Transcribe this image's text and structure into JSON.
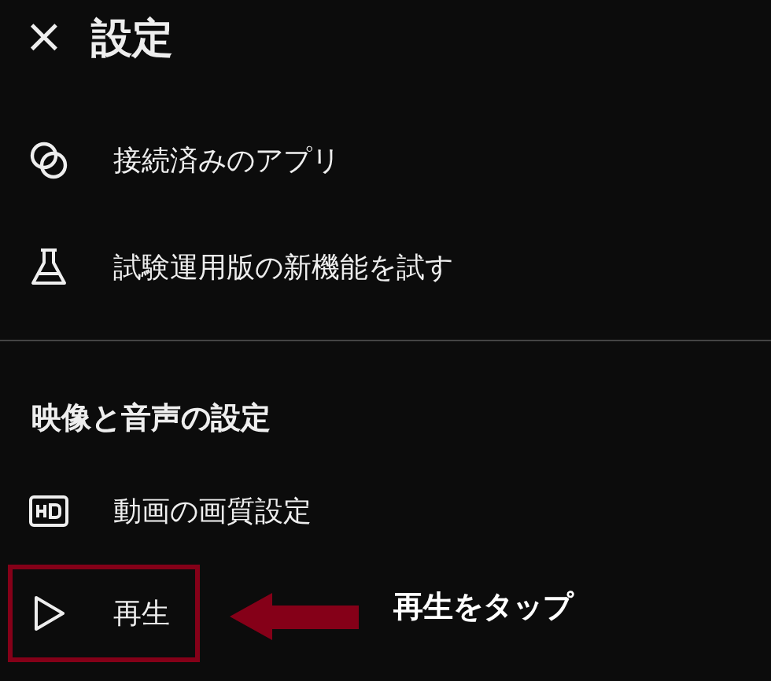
{
  "header": {
    "close_icon": "×",
    "title": "設定"
  },
  "sections": [
    {
      "items": [
        {
          "kind": "link",
          "label": "接続済みのアプリ",
          "highlighted": false
        },
        {
          "kind": "flask",
          "label": "試験運用版の新機能を試す",
          "highlighted": false
        }
      ]
    },
    {
      "title": "映像と音声の設定",
      "items": [
        {
          "kind": "hd",
          "label": "動画の画質設定",
          "highlighted": false
        },
        {
          "kind": "play",
          "label": "再生",
          "highlighted": true
        }
      ]
    }
  ],
  "annotation": {
    "text": "再生をタップ"
  }
}
